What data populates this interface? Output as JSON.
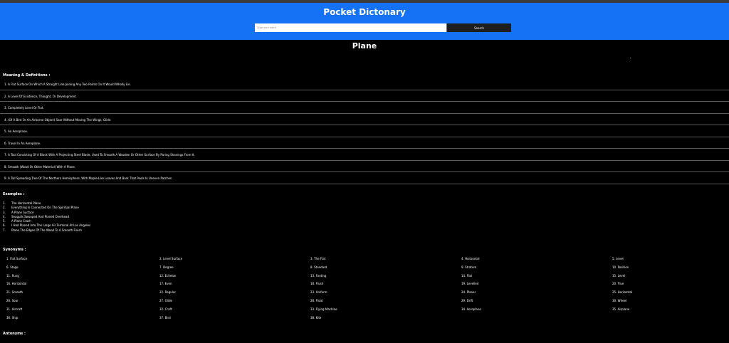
{
  "app": {
    "title": "Pocket Dictonary"
  },
  "search": {
    "placeholder": "Type your word",
    "button_label": "Search"
  },
  "word": "Plane",
  "meanings": {
    "heading": "Meaning & Definitions :",
    "items": [
      "1. A Flat Surface On Which A Straight Line Joining Any Two Points On It Would Wholly Lie.",
      "2. A Level Of Existence, Thought, Or Development.",
      "3. Completely Level Or Flat.",
      "4. (Of A Bird Or An Airborne Object) Soar Without Moving The Wings; Glide.",
      "5. An Aeroplane.",
      "6. Travel In An Aeroplane.",
      "7. A Tool Consisting Of A Block With A Projecting Steel Blade, Used To Smooth A Wooden Or Other Surface By Paring Shavings From It.",
      "8. Smooth (Wood Or Other Material) With A Plane.",
      "9. A Tall Spreading Tree Of The Northern Hemisphere, With Maple-Like Leaves And Bark That Peels In Uneven Patches."
    ]
  },
  "examples": {
    "heading": "Examples :",
    "items": [
      {
        "num": "1.",
        "text": "The Horizontal Plane"
      },
      {
        "num": "2.",
        "text": "Everything Is Connected On The Spiritual Plane"
      },
      {
        "num": "3.",
        "text": "A Plane Surface"
      },
      {
        "num": "4.",
        "text": "Seagulls Swooped And Planed Overhead"
      },
      {
        "num": "5.",
        "text": "A Plane Crash"
      },
      {
        "num": "6.",
        "text": "I Had Planed Into The Large Air Terminal At Los Angeles"
      },
      {
        "num": "7.",
        "text": "Plane The Edges Of The Wood To A Smooth Finish"
      }
    ]
  },
  "synonyms": {
    "heading": "Synonyms :",
    "items": [
      "1. Flat Surface",
      "2. Level Surface",
      "3. The Flat",
      "4. Horizontal",
      "5. Level",
      "6. Stage",
      "7. Degree",
      "8. Standard",
      "9. Stratum",
      "10. Position",
      "11. Rung",
      "12. Echelon",
      "13. Footing",
      "14. Flat",
      "15. Level",
      "16. Horizontal",
      "17. Even",
      "18. Flush",
      "19. Levelled",
      "20. True",
      "21. Smooth",
      "22. Regular",
      "23. Uniform",
      "24. Planar",
      "25. Horizontal",
      "26. Soar",
      "27. Glide",
      "28. Float",
      "29. Drift",
      "30. Wheel",
      "31. Aircraft",
      "32. Craft",
      "33. Flying Machine",
      "34. Aeroplane",
      "35. Airplane",
      "36. Ship",
      "37. Bird",
      "38. Kite"
    ]
  },
  "antonyms": {
    "heading": "Antonyms :"
  }
}
